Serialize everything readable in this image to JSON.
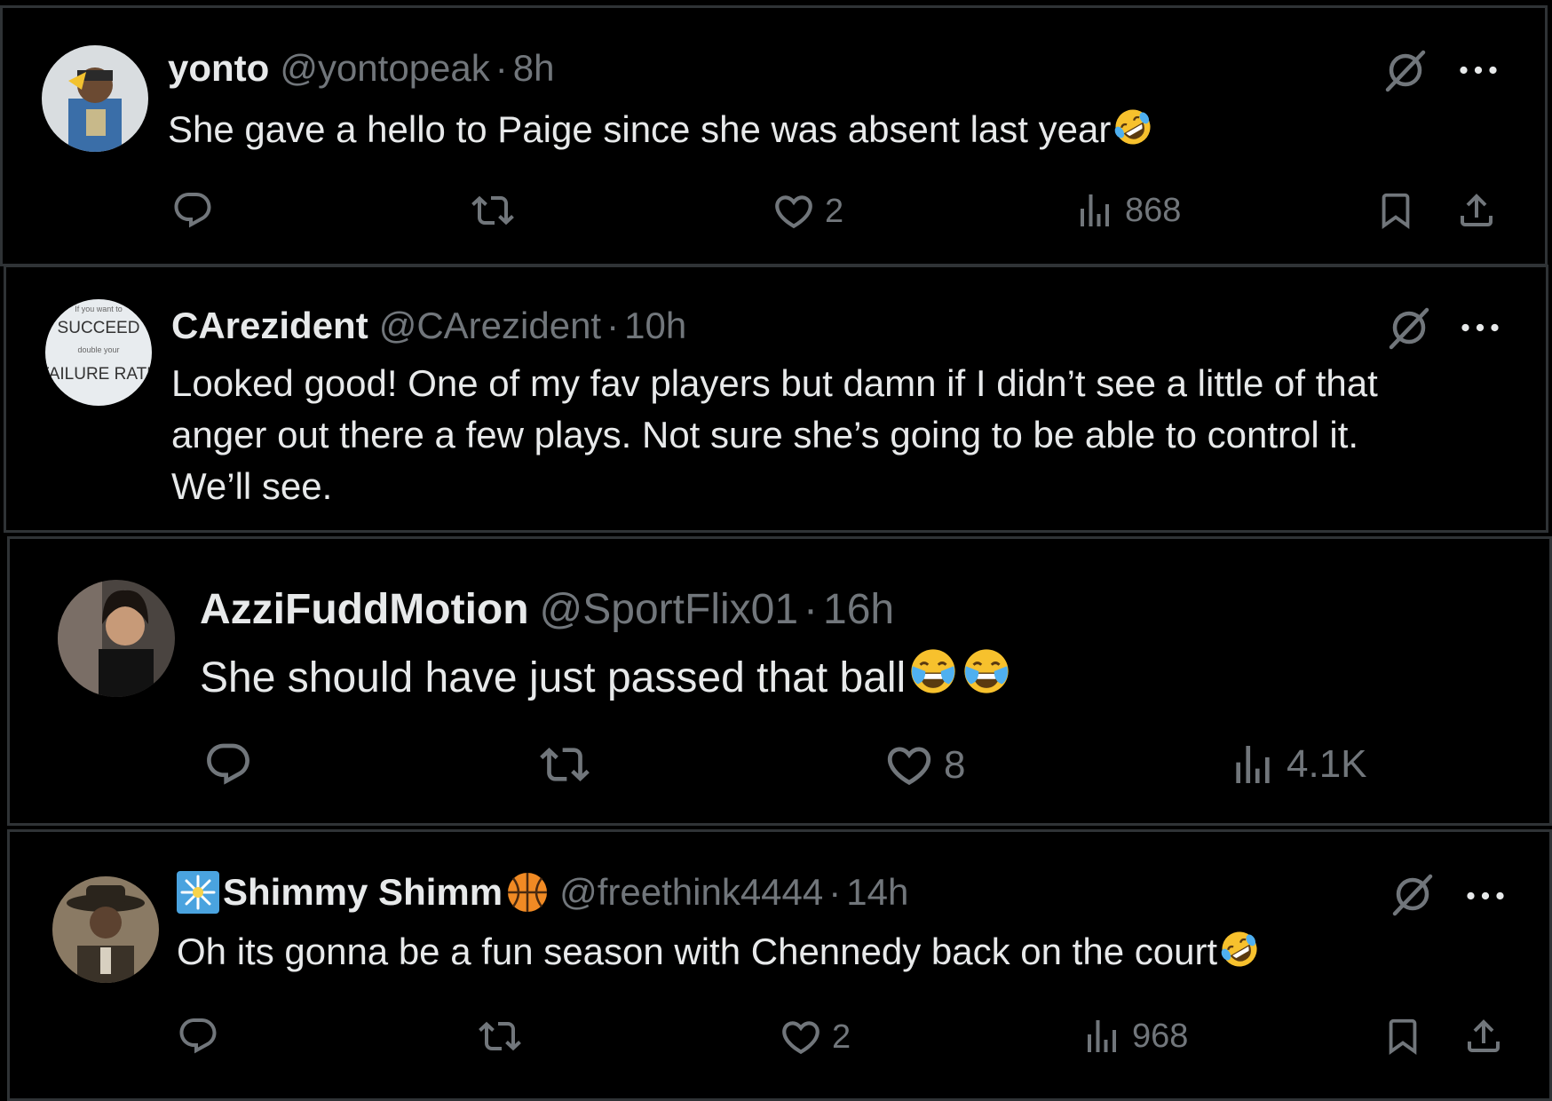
{
  "posts": [
    {
      "name": "yonto",
      "handle": "@yontopeak",
      "time": "8h",
      "text": "She gave a hello to Paige since she was absent last year",
      "likes": "2",
      "views": "868",
      "emoji": "rolling-on-floor-laughing"
    },
    {
      "name": "CArezident",
      "handle": "@CArezident",
      "time": "10h",
      "text_lines": [
        "Looked good! One of my fav players but damn if I didn’t see a little of that",
        "anger out there a few plays. Not sure she’s going to be able to control it.",
        "We’ll see."
      ],
      "avatar_text": {
        "top": "If you want to",
        "mid": "SUCCEED",
        "small": "double your",
        "bottom": "FAILURE RATE"
      }
    },
    {
      "name": "AzziFuddMotion",
      "handle": "@SportFlix01",
      "time": "16h",
      "text": "She should have just passed that ball",
      "likes": "8",
      "views": "4.1K",
      "emoji": "face-with-tears-of-joy x2"
    },
    {
      "name": "Shimmy Shimm",
      "handle": "@freethink4444",
      "time": "14h",
      "text": "Oh its gonna be a fun season with Chennedy back on the court",
      "likes": "2",
      "views": "968",
      "emoji": "rolling-on-floor-laughing"
    }
  ],
  "separator": "·",
  "colors": {
    "background": "#000000",
    "border": "#2f3336",
    "text": "#e7e9ea",
    "muted": "#71767b"
  }
}
